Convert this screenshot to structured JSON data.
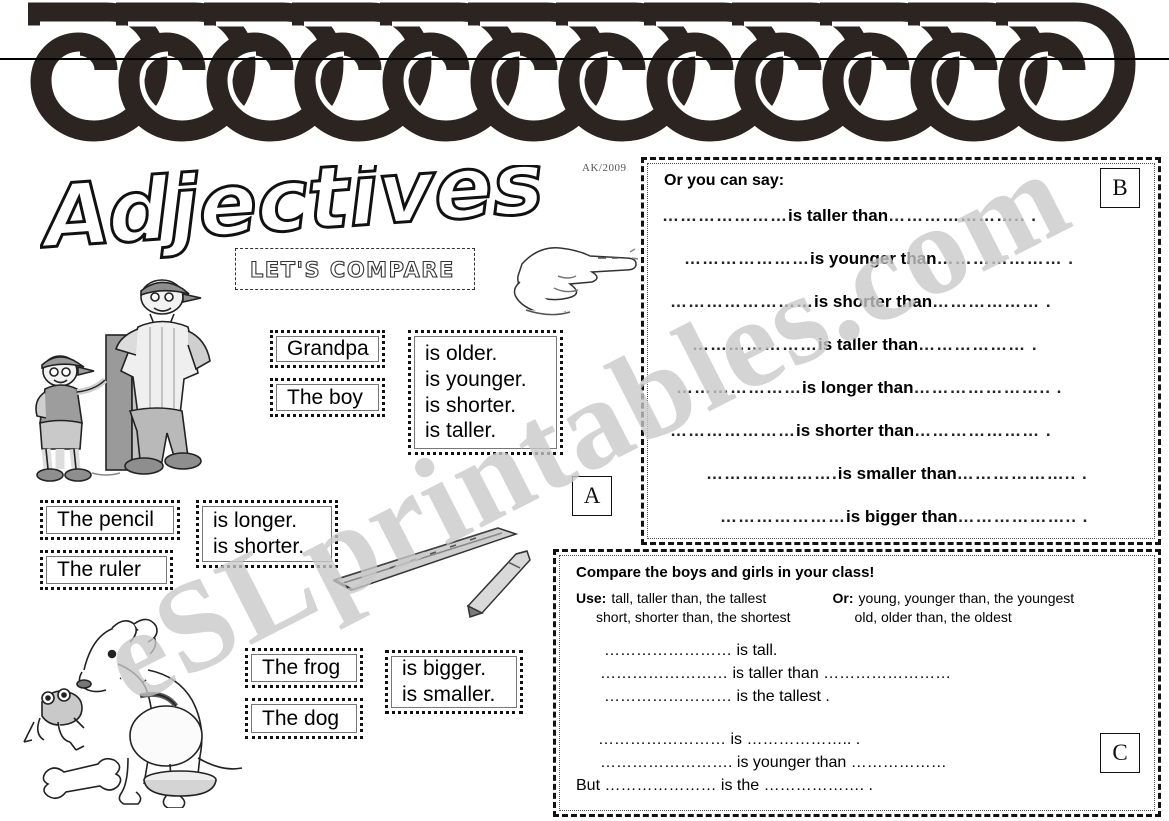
{
  "page": {
    "title": "Adjectives",
    "subtitle": "LET'S COMPARE",
    "credit": "AK/2009",
    "watermark": "eSLprintables.com"
  },
  "markers": {
    "a": "A",
    "b": "B",
    "c": "C"
  },
  "section_a": {
    "subjects_people": [
      "Grandpa",
      "The boy"
    ],
    "verbs_people": [
      "is older.",
      "is younger.",
      "is shorter.",
      "is taller."
    ],
    "subjects_objects": [
      "The pencil",
      "The ruler"
    ],
    "verbs_objects": [
      "is longer.",
      "is shorter."
    ],
    "subjects_animals": [
      "The frog",
      "The dog"
    ],
    "verbs_animals": [
      "is bigger.",
      "is smaller."
    ]
  },
  "section_b": {
    "heading": "Or you can say:",
    "lines": [
      {
        "lead": "………………… ",
        "verb": "is taller than",
        "tail": " ………………….. ."
      },
      {
        "lead": "………………… ",
        "verb": "is younger than",
        "tail": " ………………… ."
      },
      {
        "lead": "…………………… ",
        "verb": "is shorter than",
        "tail": " ……………… ."
      },
      {
        "lead": "………………… ",
        "verb": "is taller than",
        "tail": " ……………… ."
      },
      {
        "lead": "………………… ",
        "verb": "is  longer than",
        "tail": " ………………….. ."
      },
      {
        "lead": "………………… ",
        "verb": "is shorter than",
        "tail": " ………………… ."
      },
      {
        "lead": "…………………. ",
        "verb": "is smaller than",
        "tail": " ……………….. ."
      },
      {
        "lead": "………………… ",
        "verb": "is bigger than",
        "tail": " ……………….. ."
      }
    ]
  },
  "section_c": {
    "heading": "Compare the boys and girls in your class!",
    "use_label": "Use:",
    "use_line1": "tall, taller than, the tallest",
    "use_line2": "short, shorter than, the shortest",
    "or_label": "Or:",
    "or_line1": "young, younger than, the youngest",
    "or_line2": "old, older than, the oldest",
    "lines": [
      "…………………… is tall.",
      "…………………… is taller than ……………………",
      "…………………… is the tallest .",
      "…………………… is ……………….. .",
      "……………………. is younger than ………………",
      "But ………………… is the ………………. ."
    ]
  }
}
